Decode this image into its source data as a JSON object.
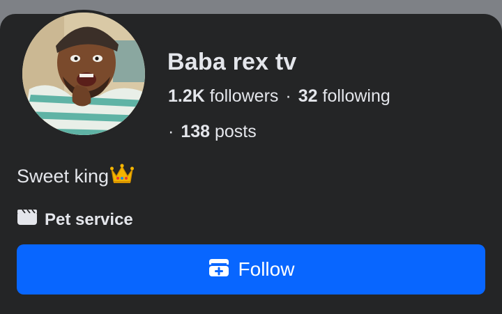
{
  "profile": {
    "name": "Baba rex tv",
    "followers_count": "1.2K",
    "followers_label": "followers",
    "following_count": "32",
    "following_label": "following",
    "posts_count": "138",
    "posts_label": "posts",
    "separator": "·",
    "bio": "Sweet king",
    "bio_emoji": "crown-emoji",
    "category": "Pet service",
    "category_icon": "clapperboard-icon"
  },
  "actions": {
    "follow_label": "Follow",
    "follow_icon": "follow-add-icon"
  },
  "colors": {
    "background": "#242526",
    "text": "#e4e6eb",
    "accent": "#0866ff"
  }
}
